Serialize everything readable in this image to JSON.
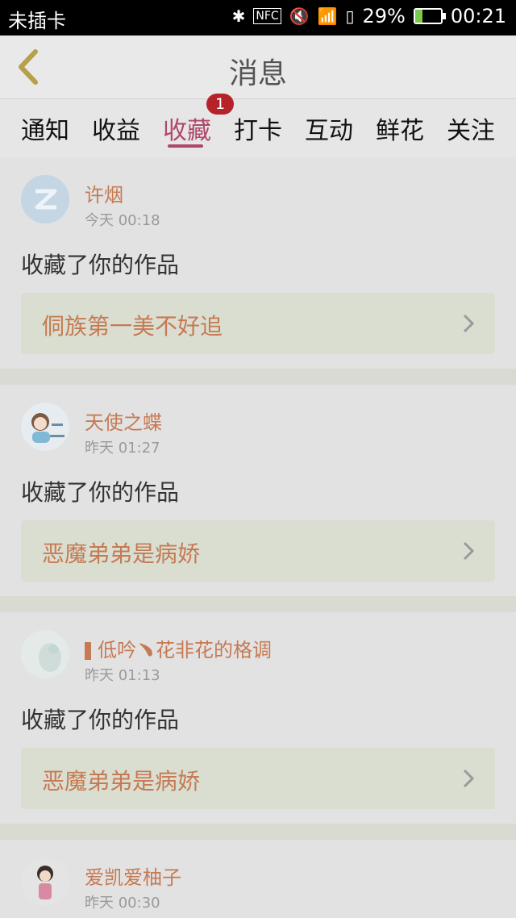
{
  "status_bar": {
    "carrier": "未插卡",
    "nfc_label": "NFC",
    "battery_percent": "29%",
    "battery_level": 0.29,
    "time": "00:21"
  },
  "header": {
    "title": "消息"
  },
  "tabs": [
    {
      "label": "通知"
    },
    {
      "label": "收益"
    },
    {
      "label": "收藏",
      "active": true
    },
    {
      "label": "打卡"
    },
    {
      "label": "互动"
    },
    {
      "label": "鲜花"
    },
    {
      "label": "关注"
    }
  ],
  "badge": {
    "count": "1"
  },
  "notifications": [
    {
      "username": "许烟",
      "time": "今天 00:18",
      "action": "收藏了你的作品",
      "work_title": "侗族第一美不好追",
      "avatar": "default-avatar-icon"
    },
    {
      "username": "天使之蝶",
      "time": "昨天 01:27",
      "action": "收藏了你的作品",
      "work_title": "恶魔弟弟是病娇",
      "avatar": "girl-avatar"
    },
    {
      "username": "低吟﹅花非花的格调",
      "time": "昨天 01:13",
      "action": "收藏了你的作品",
      "work_title": "恶魔弟弟是病娇",
      "avatar": "pale-avatar"
    },
    {
      "username": "爱凯爱柚子",
      "time": "昨天 00:30",
      "avatar": "boy-avatar"
    }
  ],
  "colors": {
    "accent": "#b0476a",
    "username": "#c67a53",
    "badge": "#b5222a"
  }
}
